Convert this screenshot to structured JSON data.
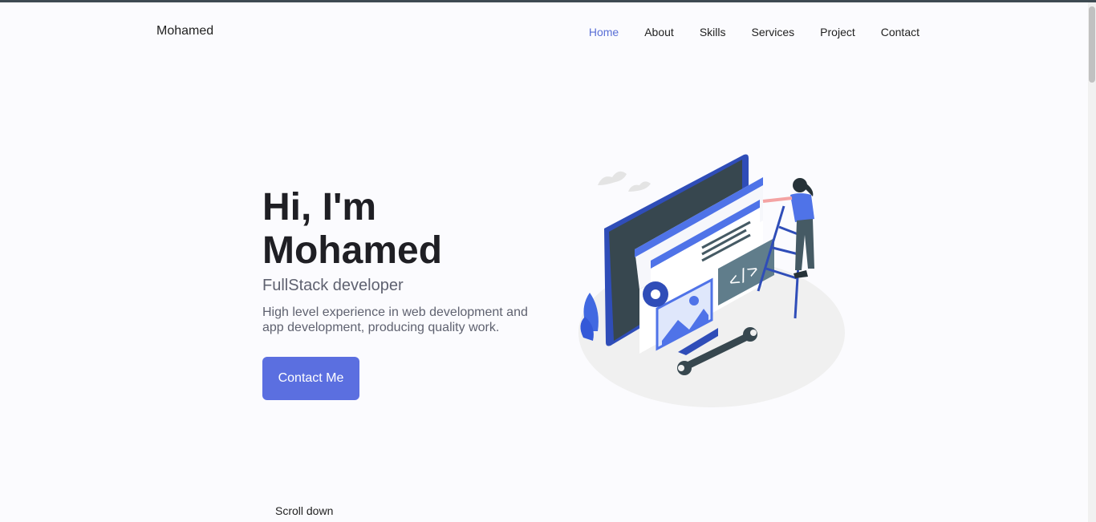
{
  "header": {
    "logo": "Mohamed",
    "nav": [
      {
        "label": "Home",
        "active": true
      },
      {
        "label": "About",
        "active": false
      },
      {
        "label": "Skills",
        "active": false
      },
      {
        "label": "Services",
        "active": false
      },
      {
        "label": "Project",
        "active": false
      },
      {
        "label": "Contact",
        "active": false
      }
    ]
  },
  "hero": {
    "title": "Hi, I'm Mohamed",
    "subtitle": "FullStack developer",
    "description": "High level experience in web development and app development, producing quality work.",
    "cta_label": "Contact Me",
    "illustration": "developer-building-website-illustration"
  },
  "scroll": {
    "label": "Scroll down"
  },
  "colors": {
    "accent": "#5b6fe0",
    "nav_active": "#5a6fd6",
    "background": "#fbfbfe",
    "text_dark": "#1f1f24",
    "text_muted": "#5f6270"
  }
}
